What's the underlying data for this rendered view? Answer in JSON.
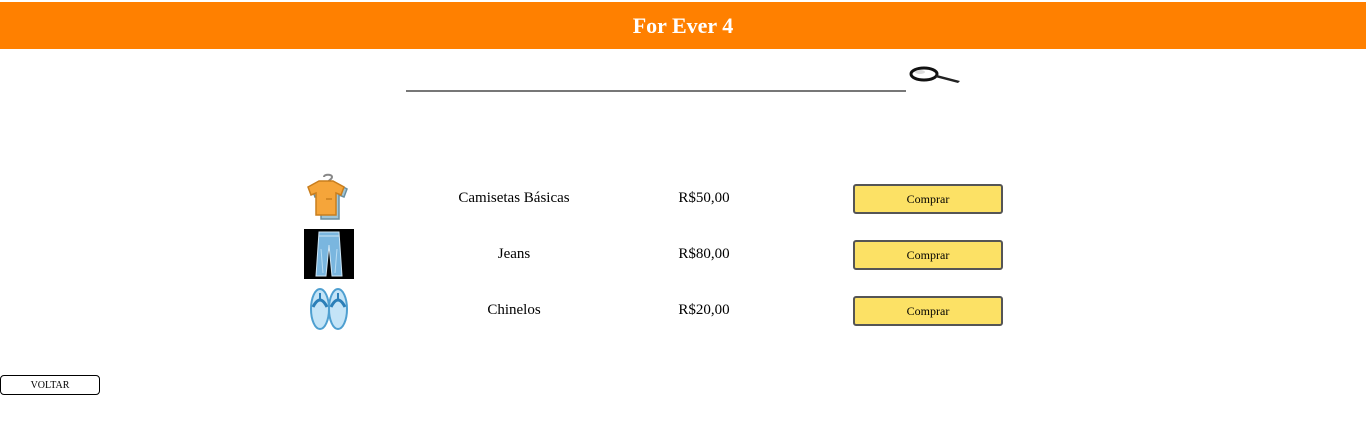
{
  "header": {
    "title": "For Ever 4",
    "background_color": "#ff8000"
  },
  "search": {
    "value": "",
    "placeholder": "",
    "icon": "magnifier-icon"
  },
  "products": [
    {
      "icon": "tshirt-icon",
      "name": "Camisetas Básicas",
      "price": "R$50,00",
      "button_label": "Comprar"
    },
    {
      "icon": "jeans-icon",
      "name": "Jeans",
      "price": "R$80,00",
      "button_label": "Comprar"
    },
    {
      "icon": "flip-flops-icon",
      "name": "Chinelos",
      "price": "R$20,00",
      "button_label": "Comprar"
    }
  ],
  "buy_button_color": "#fce165",
  "back_button": {
    "label": "VOLTAR"
  }
}
